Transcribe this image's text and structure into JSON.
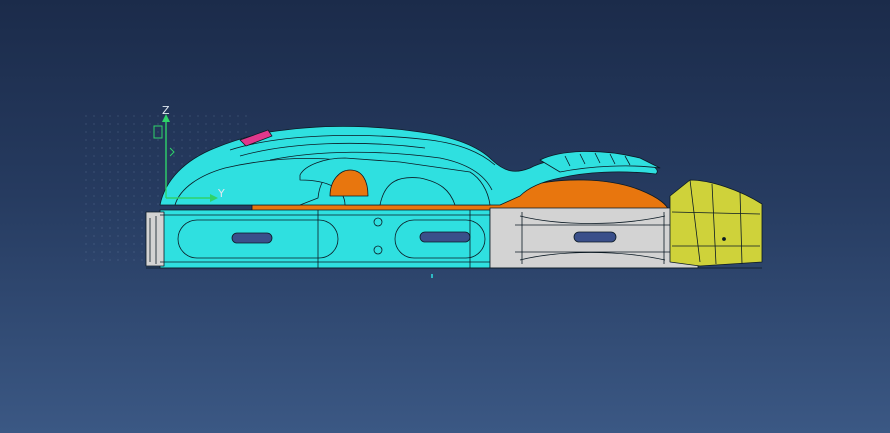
{
  "viewer": {
    "background_top": "#1b2b4a",
    "background_bottom": "#3b5884"
  },
  "compass": {
    "z_label": "Z",
    "y_label": "Y",
    "z_color": "#2fd36a",
    "y_color": "#2fd36a"
  },
  "model": {
    "part_colors": {
      "shell": "#2fe0e0",
      "inner": "#e8760e",
      "chassis": "#d3d3d3",
      "nose": "#cfd23a",
      "accent": "#e0388c",
      "edge": "#0b1a24"
    }
  }
}
